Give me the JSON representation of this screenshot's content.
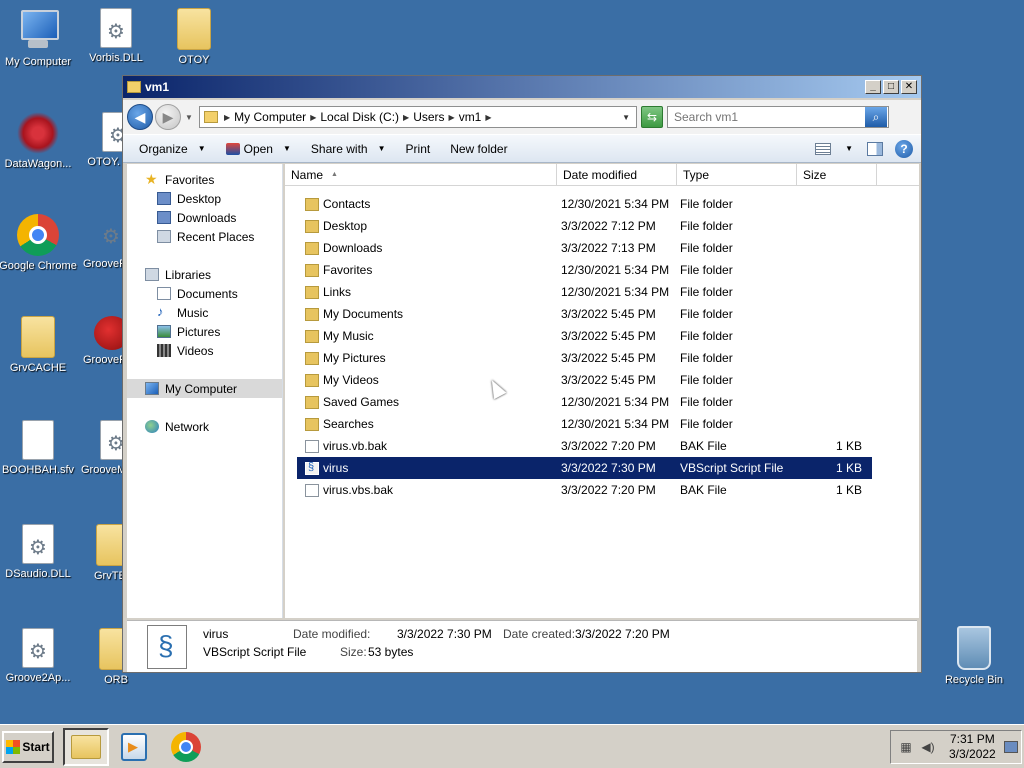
{
  "desktop": {
    "icons": [
      {
        "label": "My Computer",
        "icon": "computer-icon"
      },
      {
        "label": "Vorbis.DLL",
        "icon": "dll-file-icon"
      },
      {
        "label": "OTOY",
        "icon": "folder-icon"
      },
      {
        "label": "DataWagon...",
        "icon": "datawagon-icon"
      },
      {
        "label": "OTOY.",
        "icon": "dll-file-icon"
      },
      {
        "label": "Google Chrome",
        "icon": "chrome-icon"
      },
      {
        "label": "GrooveF",
        "icon": "gear-icon"
      },
      {
        "label": "GrvCACHE",
        "icon": "folder-icon"
      },
      {
        "label": "GrooveF",
        "icon": "ladybug-icon"
      },
      {
        "label": "BOOHBAH.sfv",
        "icon": "file-icon"
      },
      {
        "label": "GrooveM",
        "icon": "dll-file-icon"
      },
      {
        "label": "DSaudio.DLL",
        "icon": "dll-file-icon"
      },
      {
        "label": "GrvTE",
        "icon": "folder-icon"
      },
      {
        "label": "Groove2Ap...",
        "icon": "dll-file-icon"
      },
      {
        "label": "ORB",
        "icon": "folder-icon"
      },
      {
        "label": "Recycle Bin",
        "icon": "recycle-bin-icon"
      }
    ]
  },
  "window": {
    "title": "vm1",
    "controls": {
      "minimize": "_",
      "maximize": "□",
      "close": "✕"
    }
  },
  "address": {
    "crumbs": [
      "My Computer",
      "Local Disk (C:)",
      "Users",
      "vm1"
    ],
    "search_placeholder": "Search vm1"
  },
  "toolbar": {
    "organize": "Organize",
    "open": "Open",
    "share_with": "Share with",
    "print": "Print",
    "new_folder": "New folder"
  },
  "nav": {
    "favorites": "Favorites",
    "desktop": "Desktop",
    "downloads": "Downloads",
    "recent_places": "Recent Places",
    "libraries": "Libraries",
    "documents": "Documents",
    "music": "Music",
    "pictures": "Pictures",
    "videos": "Videos",
    "my_computer": "My Computer",
    "network": "Network"
  },
  "columns": {
    "name": "Name",
    "date_modified": "Date modified",
    "type": "Type",
    "size": "Size"
  },
  "files": [
    {
      "name": "Contacts",
      "date": "12/30/2021 5:34 PM",
      "type": "File folder",
      "size": "",
      "icon": "folder"
    },
    {
      "name": "Desktop",
      "date": "3/3/2022 7:12 PM",
      "type": "File folder",
      "size": "",
      "icon": "folder"
    },
    {
      "name": "Downloads",
      "date": "3/3/2022 7:13 PM",
      "type": "File folder",
      "size": "",
      "icon": "folder"
    },
    {
      "name": "Favorites",
      "date": "12/30/2021 5:34 PM",
      "type": "File folder",
      "size": "",
      "icon": "folder"
    },
    {
      "name": "Links",
      "date": "12/30/2021 5:34 PM",
      "type": "File folder",
      "size": "",
      "icon": "folder"
    },
    {
      "name": "My Documents",
      "date": "3/3/2022 5:45 PM",
      "type": "File folder",
      "size": "",
      "icon": "folder"
    },
    {
      "name": "My Music",
      "date": "3/3/2022 5:45 PM",
      "type": "File folder",
      "size": "",
      "icon": "folder"
    },
    {
      "name": "My Pictures",
      "date": "3/3/2022 5:45 PM",
      "type": "File folder",
      "size": "",
      "icon": "folder"
    },
    {
      "name": "My Videos",
      "date": "3/3/2022 5:45 PM",
      "type": "File folder",
      "size": "",
      "icon": "folder"
    },
    {
      "name": "Saved Games",
      "date": "12/30/2021 5:34 PM",
      "type": "File folder",
      "size": "",
      "icon": "folder"
    },
    {
      "name": "Searches",
      "date": "12/30/2021 5:34 PM",
      "type": "File folder",
      "size": "",
      "icon": "folder"
    },
    {
      "name": "virus.vb.bak",
      "date": "3/3/2022 7:20 PM",
      "type": "BAK File",
      "size": "1 KB",
      "icon": "file"
    },
    {
      "name": "virus",
      "date": "3/3/2022 7:30 PM",
      "type": "VBScript Script File",
      "size": "1 KB",
      "icon": "script",
      "selected": true
    },
    {
      "name": "virus.vbs.bak",
      "date": "3/3/2022 7:20 PM",
      "type": "BAK File",
      "size": "1 KB",
      "icon": "file"
    }
  ],
  "details": {
    "name": "virus",
    "type": "VBScript Script File",
    "modified_label": "Date modified:",
    "modified": "3/3/2022 7:30 PM",
    "created_label": "Date created:",
    "created": "3/3/2022 7:20 PM",
    "size_label": "Size:",
    "size": "53 bytes"
  },
  "taskbar": {
    "start_label": "Start",
    "time": "7:31 PM",
    "date": "3/3/2022"
  }
}
